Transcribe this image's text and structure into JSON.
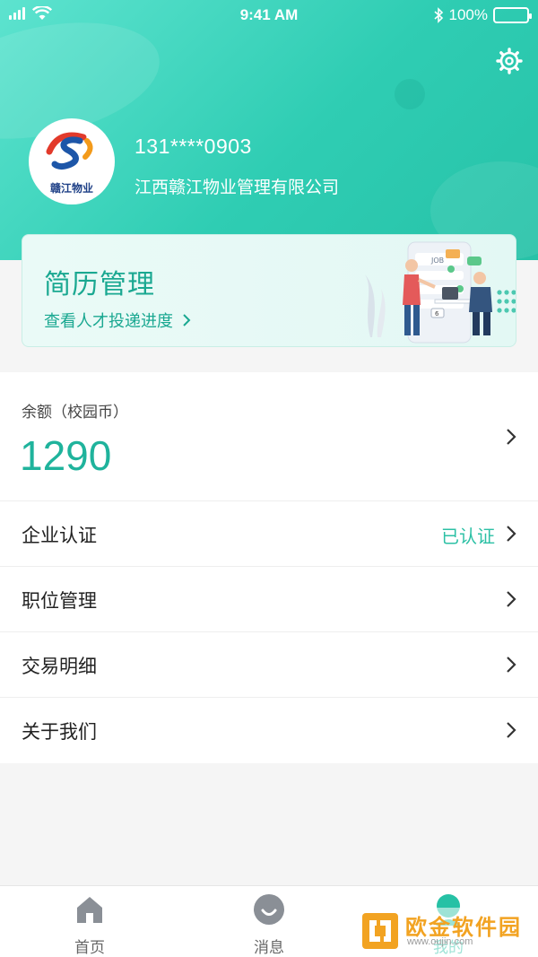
{
  "status_bar": {
    "time": "9:41 AM",
    "battery": "100%"
  },
  "profile": {
    "phone": "131****0903",
    "company": "江西赣江物业管理有限公司",
    "logo_text": "赣江物业"
  },
  "resume_card": {
    "title": "简历管理",
    "subtitle": "查看人才投递进度",
    "illustration_text": "JOB",
    "illustration_badge": "6"
  },
  "balance": {
    "label": "余额（校园币）",
    "value": "1290"
  },
  "menu": [
    {
      "label": "企业认证",
      "status": "已认证"
    },
    {
      "label": "职位管理"
    },
    {
      "label": "交易明细"
    },
    {
      "label": "关于我们"
    }
  ],
  "tabbar": {
    "tabs": [
      {
        "label": "首页",
        "icon": "home-icon"
      },
      {
        "label": "消息",
        "icon": "message-icon"
      },
      {
        "label": "我的",
        "icon": "profile-icon"
      }
    ]
  },
  "watermark": {
    "text": "欧金软件园",
    "url": "www.oujin.com"
  },
  "colors": {
    "accent": "#2cc0a5",
    "header_start": "#5de3cf",
    "header_end": "#27c2a8"
  }
}
